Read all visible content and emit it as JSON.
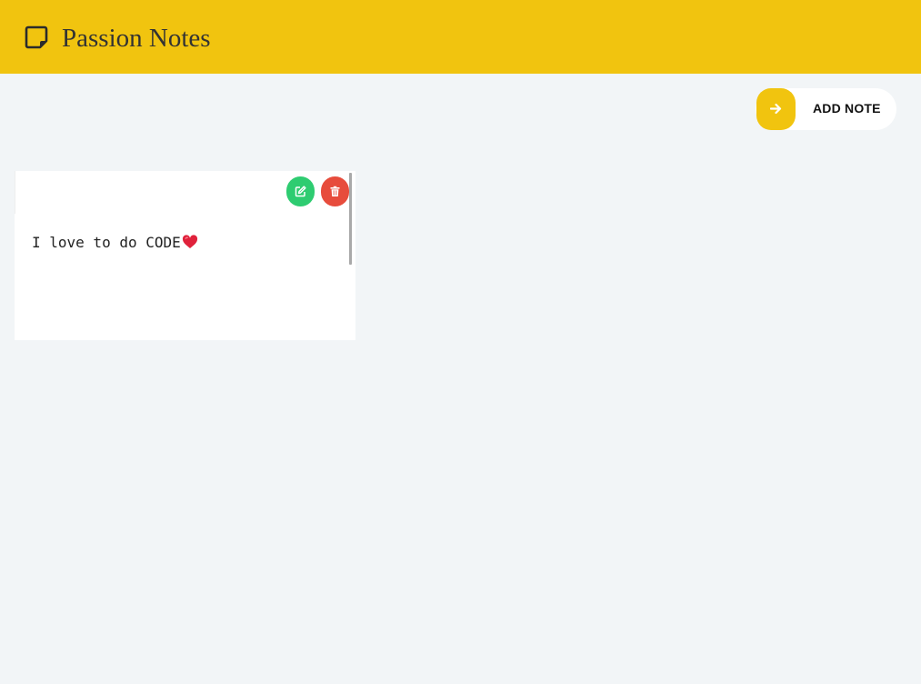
{
  "app": {
    "title": "Passion Notes",
    "brand_icon": "sticky-note-icon",
    "accent_color": "#f1c40f",
    "background_color": "#f2f5f7"
  },
  "toolbar": {
    "add_note_label": "ADD NOTE",
    "add_note_icon": "arrow-right-icon"
  },
  "notes": [
    {
      "text": "I love to do CODE",
      "emoji_icon": "red-heart-icon",
      "edit_icon": "edit-icon",
      "delete_icon": "trash-icon",
      "edit_color": "#2ecc71",
      "delete_color": "#e74c3c"
    }
  ]
}
